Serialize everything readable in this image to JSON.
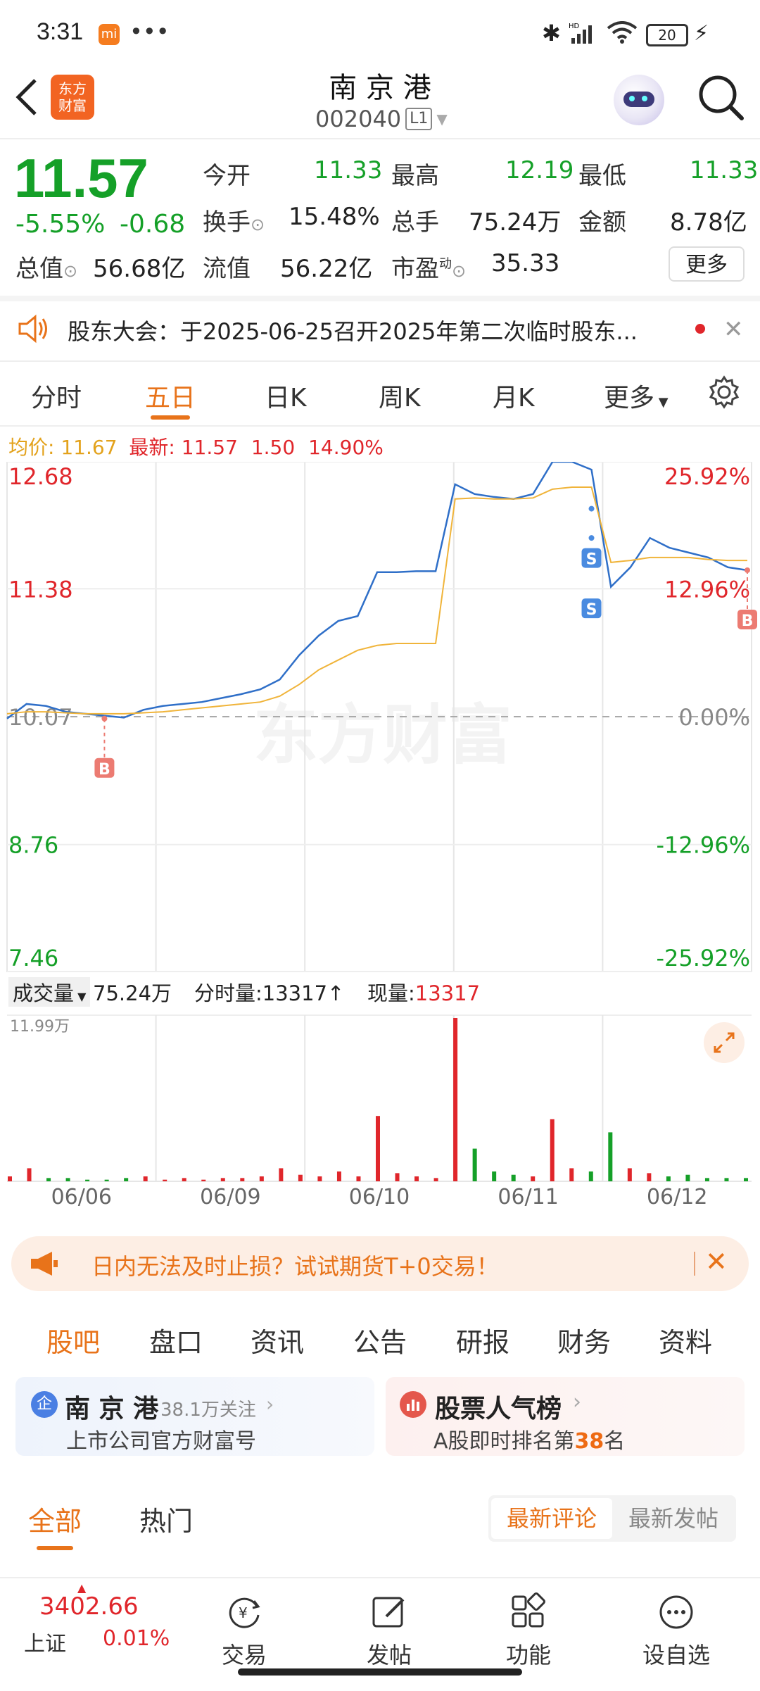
{
  "status_bar": {
    "time": "3:31",
    "app_badge": "mi",
    "battery": "20"
  },
  "header": {
    "app_logo_line1": "东方",
    "app_logo_line2": "财富",
    "stock_name": "南 京 港",
    "stock_code": "002040",
    "level_badge": "L1"
  },
  "quote": {
    "price": "11.57",
    "change_pct": "-5.55%",
    "change": "-0.68",
    "open_label": "今开",
    "open": "11.33",
    "high_label": "最高",
    "high": "12.19",
    "low_label": "最低",
    "low": "11.33",
    "turnover_label": "换手",
    "turnover": "15.48%",
    "volume_label": "总手",
    "volume": "75.24万",
    "amount_label": "金额",
    "amount": "8.78亿",
    "mcap_label": "总值",
    "mcap": "56.68亿",
    "float_label": "流值",
    "float": "56.22亿",
    "pe_label": "市盈",
    "pe_sup": "动",
    "pe": "35.33",
    "more_button": "更多"
  },
  "notice": {
    "text": "股东大会：于2025-06-25召开2025年第二次临时股东..."
  },
  "chart_tabs": [
    "分时",
    "五日",
    "日K",
    "周K",
    "月K",
    "更多"
  ],
  "chart_tabs_active": 1,
  "chart_info": {
    "avg_label": "均价:",
    "avg": "11.67",
    "latest_label": "最新:",
    "latest": "11.57",
    "diff": "1.50",
    "diff_pct": "14.90%"
  },
  "chart_data": {
    "type": "line",
    "x_labels": [
      "06/06",
      "06/09",
      "06/10",
      "06/11",
      "06/12"
    ],
    "y_left": [
      "12.68",
      "11.38",
      "10.07",
      "8.76",
      "7.46"
    ],
    "y_right": [
      "25.92%",
      "12.96%",
      "0.00%",
      "-12.96%",
      "-25.92%"
    ],
    "ylim": [
      7.46,
      12.68
    ],
    "prev_close": 10.07,
    "series": [
      {
        "values": [
          10.05,
          10.2,
          10.18,
          10.12,
          10.1,
          10.08,
          10.06,
          10.14,
          10.18,
          10.2,
          10.22,
          10.26,
          10.3,
          10.35,
          10.45,
          10.7,
          10.9,
          11.05,
          11.1,
          11.55,
          11.55,
          11.56,
          11.56,
          12.45,
          12.35,
          12.32,
          12.3,
          12.35,
          12.68,
          12.68,
          12.6,
          11.4,
          11.6,
          11.9,
          11.8,
          11.75,
          11.7,
          11.6,
          11.57
        ]
      },
      {
        "values": [
          10.1,
          10.12,
          10.12,
          10.11,
          10.1,
          10.1,
          10.1,
          10.11,
          10.12,
          10.14,
          10.16,
          10.18,
          10.2,
          10.22,
          10.28,
          10.4,
          10.55,
          10.65,
          10.75,
          10.8,
          10.82,
          10.82,
          10.82,
          12.3,
          12.31,
          12.3,
          12.3,
          12.31,
          12.4,
          12.42,
          12.42,
          11.65,
          11.67,
          11.7,
          11.7,
          11.7,
          11.68,
          11.67,
          11.67
        ]
      }
    ],
    "markers": [
      {
        "label": "B",
        "x_index": 5,
        "value": 10.05
      },
      {
        "label": "S",
        "x_index": 30,
        "value": 12.2
      },
      {
        "label": "S",
        "x_index": 30,
        "value": 11.9
      },
      {
        "label": "B",
        "x_index": 38,
        "value": 11.57
      }
    ],
    "volume_values": [
      3,
      8,
      2,
      2,
      1,
      1,
      2,
      3,
      1,
      2,
      1,
      2,
      2,
      3,
      8,
      4,
      3,
      6,
      3,
      40,
      5,
      3,
      2,
      100,
      20,
      6,
      4,
      3,
      38,
      8,
      6,
      30,
      8,
      5,
      3,
      4,
      2,
      2,
      2
    ]
  },
  "watermark": "东方财富",
  "volume_info": {
    "label": "成交量",
    "total": "75.24万",
    "tick_label": "分时量:",
    "tick": "13317↑",
    "now_label": "现量:",
    "now": "13317",
    "max": "11.99万"
  },
  "promo": {
    "text": "日内无法及时止损？试试期货T+0交易！"
  },
  "section_tabs": [
    "股吧",
    "盘口",
    "资讯",
    "公告",
    "研报",
    "财务",
    "资料"
  ],
  "section_tabs_active": 0,
  "cards": {
    "left_badge": "企",
    "left_title": "南 京 港",
    "left_follow": "38.1万关注",
    "left_sub": "上市公司官方财富号",
    "right_title": "股票人气榜",
    "right_sub_pre": "A股即时排名第",
    "right_rank": "38",
    "right_sub_post": "名"
  },
  "feed_tabs": {
    "all": "全部",
    "hot": "热门",
    "latest_comment": "最新评论",
    "latest_post": "最新发帖"
  },
  "bottom_nav": {
    "index_value": "3402.66",
    "index_name": "上证",
    "index_change": "0.01%",
    "trade": "交易",
    "post": "发帖",
    "function": "功能",
    "watchlist": "设自选"
  }
}
